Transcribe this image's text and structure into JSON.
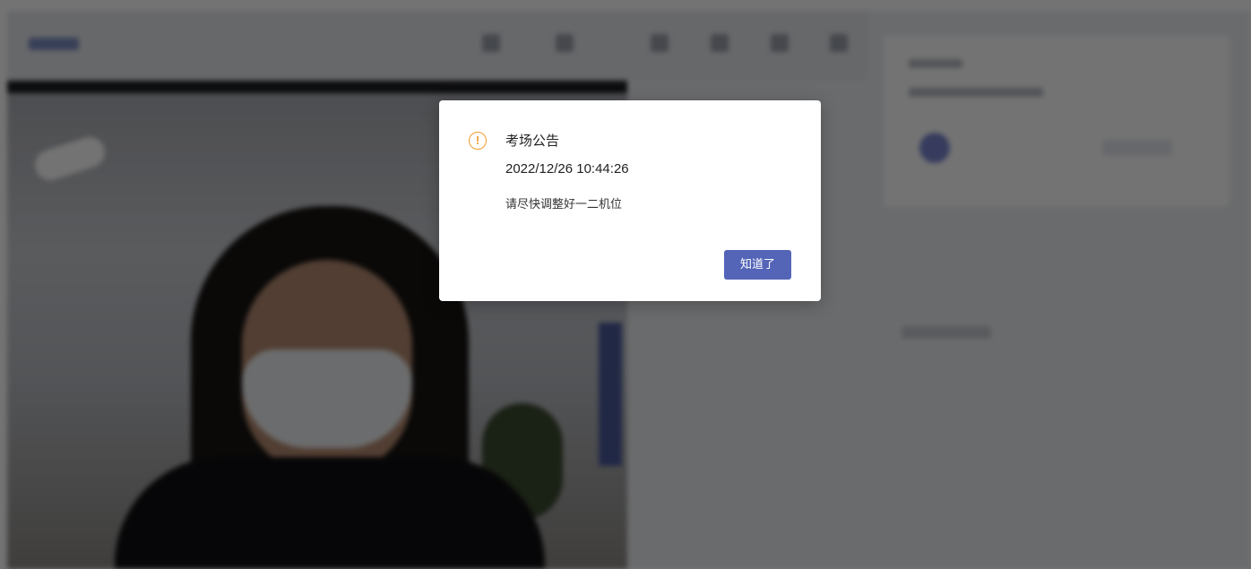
{
  "background": {
    "accent_color": "#5465b8"
  },
  "dialog": {
    "icon": "warning-circle-icon",
    "icon_glyph": "!",
    "icon_color": "#f29a2e",
    "title": "考场公告",
    "timestamp": "2022/12/26 10:44:26",
    "message": "请尽快调整好一二机位",
    "confirm_label": "知道了"
  }
}
